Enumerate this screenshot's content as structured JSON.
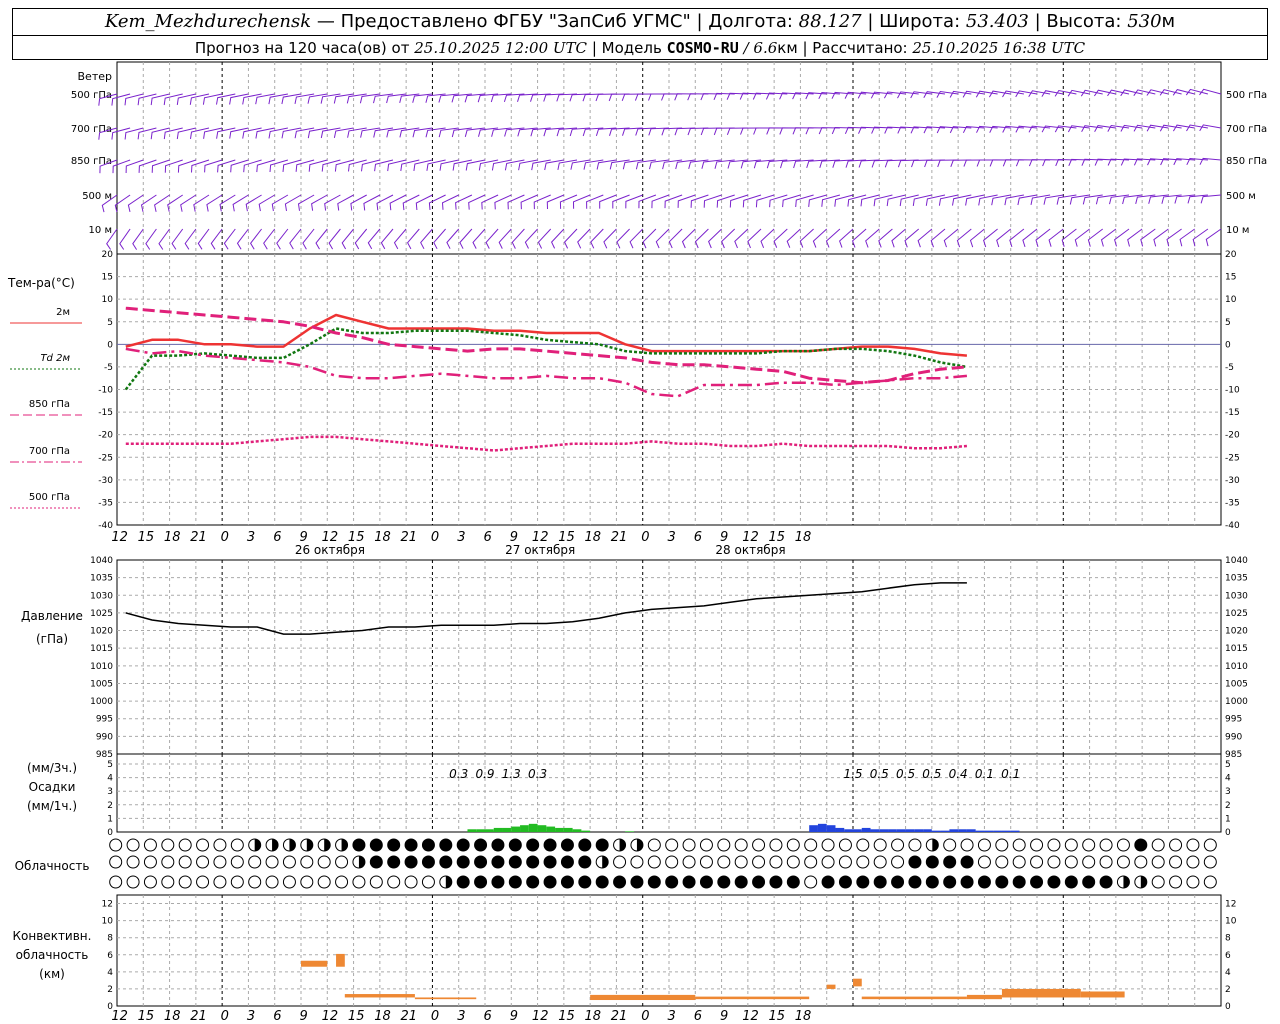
{
  "header": {
    "station": "Kem_Mezhdurechensk",
    "provider": "— Предоставлено ФГБУ \"ЗапСиб УГМС\"",
    "lon_label": "Долгота:",
    "lon_value": "88.127",
    "lat_label": "Широта:",
    "lat_value": "53.403",
    "alt_label": "Высота:",
    "alt_value": "530",
    "alt_unit": "м",
    "forecast_label": "Прогноз на 120 часа(ов)  от",
    "forecast_start": "25.10.2025 12:00 UTC",
    "model_label": "Модель",
    "model_name": "COSMO-RU",
    "model_res": "/ 6.6",
    "model_res_unit": "км",
    "calc_label": "Рассчитано:",
    "calc_time": "25.10.2025 16:38 UTC"
  },
  "time_ticks": [
    "12",
    "15",
    "18",
    "21",
    "0",
    "3",
    "6",
    "9",
    "12",
    "15",
    "18",
    "21",
    "0",
    "3",
    "6",
    "9",
    "12",
    "15",
    "18",
    "21",
    "0",
    "3",
    "6",
    "9",
    "12",
    "15",
    "18"
  ],
  "day_labels": [
    {
      "step": 8,
      "text": "26 октября"
    },
    {
      "step": 16,
      "text": "27 октября"
    },
    {
      "step": 24,
      "text": "28 октября"
    }
  ],
  "labels": {
    "wind": "Ветер",
    "wind_levels": [
      "500 гПа",
      "700 гПа",
      "850 гПа",
      "500  м",
      "10   м"
    ],
    "temp": "Тем-ра(°С)",
    "temp_legend": [
      "2м",
      "Td  2м",
      "850 гПа",
      "700 гПа",
      "500 гПа"
    ],
    "pressure": "Давление",
    "pressure_unit": "(гПа)",
    "precip": [
      "(мм/3ч.)",
      "Осадки",
      "(мм/1ч.)"
    ],
    "cloud": "Облачность",
    "conv": [
      "Конвективн.",
      "облачность",
      "(км)"
    ]
  },
  "colors": {
    "wind": "#7a22cc",
    "t2m": "#ee3333",
    "td2m": "#117711",
    "t850": "#e0207a",
    "t700": "#e0207a",
    "t500": "#e0207a",
    "pressure": "#000000",
    "precip_rain": "#22bb22",
    "precip_snow": "#2244dd",
    "conv": "#ee8833",
    "grid": "#aaaaaa"
  },
  "chart_data": [
    {
      "type": "wind_barbs",
      "levels": [
        "500 гПа",
        "700 гПа",
        "850 гПа",
        "500  м",
        "10   м"
      ]
    },
    {
      "type": "line",
      "ylabel": "Тем-ра(°С)",
      "ylim": [
        -40,
        20
      ],
      "yticks": [
        20,
        15,
        10,
        5,
        0,
        -5,
        -10,
        -15,
        -20,
        -25,
        -30,
        -35,
        -40
      ],
      "step_hours": 3,
      "series": [
        {
          "name": "2м",
          "key": "t2m",
          "style": "solid",
          "values": [
            -0.5,
            1,
            1,
            0,
            0,
            -0.5,
            -0.5,
            3.5,
            6.5,
            5,
            3.5,
            3.5,
            3.5,
            3.5,
            3,
            3,
            2.5,
            2.5,
            2.5,
            0,
            -1.5,
            -1.5,
            -1.5,
            -1.5,
            -1.5,
            -1.5,
            -1.5,
            -1,
            -0.5,
            -0.5,
            -1,
            -2,
            -2.5
          ]
        },
        {
          "name": "Td  2м",
          "key": "td2m",
          "style": "dot",
          "values": [
            -10,
            -2.5,
            -2.5,
            -2,
            -2.5,
            -3,
            -3,
            0,
            3.5,
            2.5,
            2.5,
            3,
            3,
            3,
            2.5,
            2,
            1,
            0.5,
            0,
            -1.5,
            -2,
            -2,
            -2,
            -2,
            -2,
            -1.5,
            -1.5,
            -1,
            -1,
            -1.5,
            -2.5,
            -4,
            -5
          ]
        },
        {
          "name": "850 гПа",
          "key": "t850",
          "style": "dash",
          "values": [
            8,
            7.5,
            7,
            6.5,
            6,
            5.5,
            5,
            4,
            2.5,
            1.5,
            0,
            -0.5,
            -1,
            -1.5,
            -1,
            -1,
            -1.5,
            -2,
            -2.5,
            -3,
            -4,
            -4.5,
            -4.5,
            -5,
            -5.5,
            -6,
            -7.5,
            -8,
            -8.5,
            -8,
            -6.5,
            -5.5,
            -5
          ]
        },
        {
          "name": "700 гПа",
          "key": "t700",
          "style": "dashdot",
          "values": [
            -1,
            -2,
            -1.5,
            -2.5,
            -3,
            -3.5,
            -4,
            -5,
            -7,
            -7.5,
            -7.5,
            -7,
            -6.5,
            -7,
            -7.5,
            -7.5,
            -7,
            -7.5,
            -7.5,
            -8.5,
            -11,
            -11.5,
            -9,
            -9,
            -9,
            -8.5,
            -8.5,
            -9,
            -8.5,
            -8,
            -7.5,
            -7.5,
            -7
          ]
        },
        {
          "name": "500 гПа",
          "key": "t500",
          "style": "dot",
          "values": [
            -22,
            -22,
            -22,
            -22,
            -22,
            -21.5,
            -21,
            -20.5,
            -20.5,
            -21,
            -21.5,
            -22,
            -22.5,
            -23,
            -23.5,
            -23,
            -22.5,
            -22,
            -22,
            -22,
            -21.5,
            -22,
            -22,
            -22.5,
            -22.5,
            -22,
            -22.5,
            -22.5,
            -22.5,
            -22.5,
            -23,
            -23,
            -22.5
          ]
        }
      ]
    },
    {
      "type": "line",
      "ylabel": "Давление (гПа)",
      "ylim": [
        985,
        1040
      ],
      "yticks": [
        1040,
        1035,
        1030,
        1025,
        1020,
        1015,
        1010,
        1005,
        1000,
        995,
        990,
        985
      ],
      "step_hours": 3,
      "series": [
        {
          "name": "Давление",
          "key": "pressure",
          "values": [
            1025,
            1023,
            1022,
            1021.5,
            1021,
            1021,
            1019,
            1019,
            1019.5,
            1020,
            1021,
            1021,
            1021.5,
            1021.5,
            1021.5,
            1022,
            1022,
            1022.5,
            1023.5,
            1025,
            1026,
            1026.5,
            1027,
            1028,
            1029,
            1029.5,
            1030,
            1030.5,
            1031,
            1032,
            1033,
            1033.5,
            1033.5
          ]
        }
      ]
    },
    {
      "type": "bar",
      "ylabel": "Осадки",
      "ylim": [
        0,
        5
      ],
      "yticks": [
        5,
        4,
        3,
        2,
        1,
        0
      ],
      "step_hours": 1,
      "bars": [
        {
          "h": 40,
          "v": 0.2,
          "kind": "rain"
        },
        {
          "h": 41,
          "v": 0.2,
          "kind": "rain"
        },
        {
          "h": 42,
          "v": 0.2,
          "kind": "rain"
        },
        {
          "h": 43,
          "v": 0.3,
          "kind": "rain"
        },
        {
          "h": 44,
          "v": 0.3,
          "kind": "rain"
        },
        {
          "h": 45,
          "v": 0.4,
          "kind": "rain"
        },
        {
          "h": 46,
          "v": 0.5,
          "kind": "rain"
        },
        {
          "h": 47,
          "v": 0.6,
          "kind": "rain"
        },
        {
          "h": 48,
          "v": 0.5,
          "kind": "rain"
        },
        {
          "h": 49,
          "v": 0.4,
          "kind": "rain"
        },
        {
          "h": 50,
          "v": 0.3,
          "kind": "rain"
        },
        {
          "h": 51,
          "v": 0.3,
          "kind": "rain"
        },
        {
          "h": 52,
          "v": 0.2,
          "kind": "rain"
        },
        {
          "h": 53,
          "v": 0.1,
          "kind": "rain"
        },
        {
          "h": 58,
          "v": 0.05,
          "kind": "rain"
        },
        {
          "h": 79,
          "v": 0.5,
          "kind": "snow"
        },
        {
          "h": 80,
          "v": 0.6,
          "kind": "snow"
        },
        {
          "h": 81,
          "v": 0.5,
          "kind": "snow"
        },
        {
          "h": 82,
          "v": 0.3,
          "kind": "snow"
        },
        {
          "h": 83,
          "v": 0.2,
          "kind": "snow"
        },
        {
          "h": 84,
          "v": 0.2,
          "kind": "snow"
        },
        {
          "h": 85,
          "v": 0.3,
          "kind": "snow"
        },
        {
          "h": 86,
          "v": 0.2,
          "kind": "snow"
        },
        {
          "h": 87,
          "v": 0.2,
          "kind": "snow"
        },
        {
          "h": 88,
          "v": 0.2,
          "kind": "snow"
        },
        {
          "h": 89,
          "v": 0.2,
          "kind": "snow"
        },
        {
          "h": 90,
          "v": 0.2,
          "kind": "snow"
        },
        {
          "h": 91,
          "v": 0.2,
          "kind": "snow"
        },
        {
          "h": 92,
          "v": 0.2,
          "kind": "snow"
        },
        {
          "h": 93,
          "v": 0.1,
          "kind": "snow"
        },
        {
          "h": 94,
          "v": 0.1,
          "kind": "snow"
        },
        {
          "h": 95,
          "v": 0.2,
          "kind": "snow"
        },
        {
          "h": 96,
          "v": 0.2,
          "kind": "snow"
        },
        {
          "h": 97,
          "v": 0.2,
          "kind": "snow"
        },
        {
          "h": 98,
          "v": 0.1,
          "kind": "snow"
        },
        {
          "h": 99,
          "v": 0.1,
          "kind": "snow"
        },
        {
          "h": 100,
          "v": 0.1,
          "kind": "snow"
        },
        {
          "h": 101,
          "v": 0.1,
          "kind": "snow"
        },
        {
          "h": 102,
          "v": 0.1,
          "kind": "snow"
        }
      ],
      "totals": [
        {
          "h": 39,
          "text": "0.3"
        },
        {
          "h": 42,
          "text": "0.9"
        },
        {
          "h": 45,
          "text": "1.3"
        },
        {
          "h": 48,
          "text": "0.3"
        },
        {
          "h": 84,
          "text": "1.5"
        },
        {
          "h": 87,
          "text": "0.5"
        },
        {
          "h": 90,
          "text": "0.5"
        },
        {
          "h": 93,
          "text": "0.5"
        },
        {
          "h": 96,
          "text": "0.4"
        },
        {
          "h": 99,
          "text": "0.1"
        },
        {
          "h": 102,
          "text": "0.1"
        }
      ]
    },
    {
      "type": "cloud_symbols",
      "rows": [
        "upper",
        "middle",
        "lower"
      ]
    },
    {
      "type": "bar",
      "ylabel": "Конвективн. облачность (км)",
      "ylim": [
        0,
        13
      ],
      "yticks": [
        12,
        10,
        8,
        6,
        4,
        2,
        0
      ],
      "step_hours": 1,
      "segments": [
        {
          "h0": 21,
          "h1": 24,
          "bottom": 4.6,
          "top": 5.3
        },
        {
          "h0": 25,
          "h1": 26,
          "bottom": 4.6,
          "top": 6.1
        },
        {
          "h0": 26,
          "h1": 34,
          "bottom": 1.0,
          "top": 1.4
        },
        {
          "h0": 34,
          "h1": 41,
          "bottom": 0.8,
          "top": 1.0
        },
        {
          "h0": 54,
          "h1": 66,
          "bottom": 0.7,
          "top": 1.3
        },
        {
          "h0": 66,
          "h1": 79,
          "bottom": 0.8,
          "top": 1.1
        },
        {
          "h0": 81,
          "h1": 82,
          "bottom": 2.0,
          "top": 2.5
        },
        {
          "h0": 84,
          "h1": 85,
          "bottom": 2.3,
          "top": 3.2
        },
        {
          "h0": 85,
          "h1": 97,
          "bottom": 0.8,
          "top": 1.1
        },
        {
          "h0": 97,
          "h1": 101,
          "bottom": 0.8,
          "top": 1.3
        },
        {
          "h0": 101,
          "h1": 110,
          "bottom": 1.0,
          "top": 2.0
        },
        {
          "h0": 110,
          "h1": 115,
          "bottom": 1.0,
          "top": 1.7
        }
      ]
    }
  ]
}
